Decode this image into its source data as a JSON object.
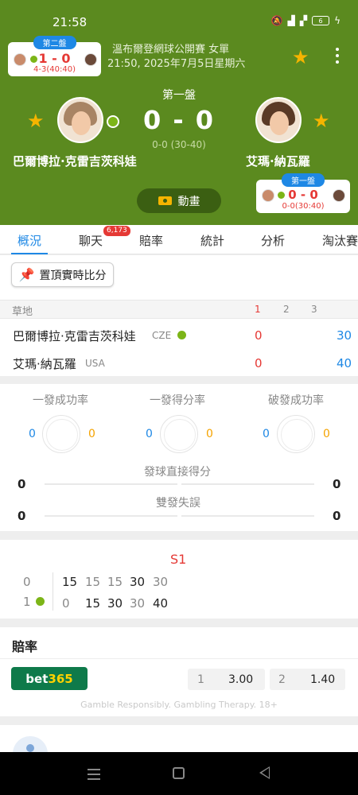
{
  "status_bar": {
    "time": "21:58",
    "battery": "6"
  },
  "header": {
    "tournament": "溫布爾登網球公開賽 女單",
    "datetime": "21:50, 2025年7月5日星期六",
    "current_set_label": "第一盤",
    "score": "0 - 0",
    "game_score": "0-0 (30-40)",
    "animation_label": "動畫"
  },
  "mini_card_left": {
    "tag": "第二盤",
    "score": "1 - 0",
    "sub": "4-3(40:40)"
  },
  "mini_card_right": {
    "tag": "第一盤",
    "score": "0 - 0",
    "sub": "0-0(30:40)"
  },
  "players": {
    "home": {
      "name": "巴爾博拉·克雷吉茨科娃",
      "country": "CZE"
    },
    "away": {
      "name": "艾瑪·納瓦羅",
      "country": "USA"
    }
  },
  "tabs": [
    {
      "label": "概況"
    },
    {
      "label": "聊天"
    },
    {
      "label": "賠率"
    },
    {
      "label": "統計"
    },
    {
      "label": "分析"
    },
    {
      "label": "淘汰賽"
    }
  ],
  "chat_badge": "6,173",
  "pin_button": "置頂實時比分",
  "scoreboard": {
    "surface": "草地",
    "set_headers": [
      "1",
      "2",
      "3"
    ],
    "home_set": "0",
    "home_points": "30",
    "away_set": "0",
    "away_points": "40"
  },
  "stats": {
    "circles": [
      {
        "label": "一發成功率",
        "home": "0",
        "away": "0"
      },
      {
        "label": "一發得分率",
        "home": "0",
        "away": "0"
      },
      {
        "label": "破發成功率",
        "home": "0",
        "away": "0"
      }
    ],
    "aces": {
      "label": "發球直接得分",
      "home": "0",
      "away": "0"
    },
    "double_faults": {
      "label": "雙發失誤",
      "home": "0",
      "away": "0"
    }
  },
  "point_by_point": {
    "set_label": "S1",
    "rows": [
      {
        "game": "0",
        "points": [
          "15",
          "15",
          "15",
          "30",
          "30"
        ]
      },
      {
        "game": "1",
        "points": [
          "0",
          "15",
          "30",
          "30",
          "40"
        ]
      }
    ]
  },
  "odds": {
    "title": "賠率",
    "bookmaker_a": "bet",
    "bookmaker_b": "365",
    "home_label": "1",
    "home_value": "3.00",
    "away_label": "2",
    "away_value": "1.40",
    "disclaimer": "Gamble Responsibly. Gambling Therapy. 18+"
  },
  "colors": {
    "header_green": "#5b8a1f",
    "accent_blue": "#1e88e5",
    "score_red": "#e53935",
    "star_gold": "#f5b400",
    "serve_green": "#7cb518"
  }
}
